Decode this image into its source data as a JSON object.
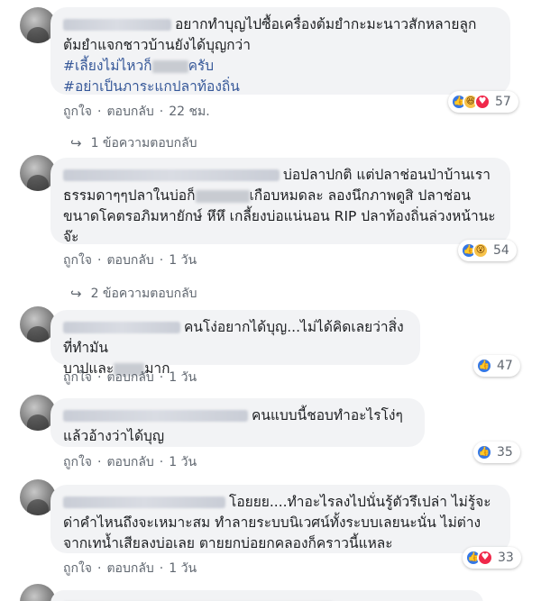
{
  "comments": [
    {
      "text": "อยากทำบุญไปซื้อเครื่องต้มยำกะมะนาวสักหลายลูก ต้มยำแจกชาวบ้านยังได้บุญกว่า",
      "hashtags": [
        "#เลี้ยงไม่ไหวก็",
        "ครับ",
        "#อย่าเป็นภาระแกปลาท้องถิ่น"
      ],
      "like": "ถูกใจ",
      "reply": "ตอบกลับ",
      "time": "22 ชม.",
      "reaction_count": "57",
      "reactions": [
        "like-icon",
        "haha-icon",
        "love-icon"
      ],
      "replies_text": "1 ข้อความตอบกลับ"
    },
    {
      "text": "บ่อปลาปกติ แต่ปลาช่อนป่าบ้านเราธรรมดาๆๆปลาในบ่อก็",
      "text_b": "เกือบหมดละ ลองนึกภาพดูสิ ปลาช่อนขนาดโคตรอภิมหายักษ์ หึหึ เกลี้ยงบ่อแน่นอน RIP ปลาท้องถิ่นล่วงหน้านะจ๊ะ",
      "like": "ถูกใจ",
      "reply": "ตอบกลับ",
      "time": "1 วัน",
      "reaction_count": "54",
      "reactions": [
        "like-icon",
        "wow-icon"
      ],
      "replies_text": "2 ข้อความตอบกลับ"
    },
    {
      "text": "คนโง่อยากได้บุญ...ไม่ได้คิดเลยว่าสิ่งที่ทำมัน",
      "text_b": "บาปและ",
      "text_c": "มาก",
      "like": "ถูกใจ",
      "reply": "ตอบกลับ",
      "time": "1 วัน",
      "reaction_count": "47",
      "reactions": [
        "like-icon"
      ]
    },
    {
      "text": "คนแบบนี้ชอบทำอะไรโง่ๆแล้วอ้างว่าได้บุญ",
      "like": "ถูกใจ",
      "reply": "ตอบกลับ",
      "time": "1 วัน",
      "reaction_count": "35",
      "reactions": [
        "like-icon"
      ]
    },
    {
      "text": "โอยยย....ทำอะไรลงไปนั่นรู้ตัวรึเปล่า ไม่รู้จะด่าคำไหนถึงจะเหมาะสม ทำลายระบบนิเวศน์ทั้งระบบเลยนะนั่น ไม่ต่างจากเทน้ำเสียลงบ่อเลย ตายยกบ่อยกคลองก็คราวนี้แหละ",
      "like": "ถูกใจ",
      "reply": "ตอบกลับ",
      "time": "1 วัน",
      "reaction_count": "33",
      "reactions": [
        "like-icon",
        "love-icon"
      ]
    }
  ],
  "separator": "·",
  "colors": {
    "bubble": "#f2f3f5",
    "link": "#365899",
    "meta": "#606770",
    "like": "#3578e5",
    "love": "#f0284a"
  }
}
